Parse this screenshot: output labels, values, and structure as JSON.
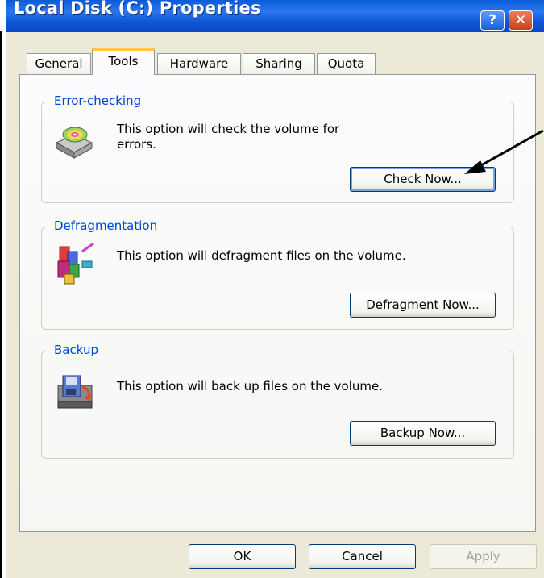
{
  "window": {
    "title": "Local Disk (C:) Properties",
    "help_glyph": "?",
    "close_glyph": "✕"
  },
  "tabs": [
    {
      "label": "General",
      "active": false
    },
    {
      "label": "Tools",
      "active": true
    },
    {
      "label": "Hardware",
      "active": false
    },
    {
      "label": "Sharing",
      "active": false
    },
    {
      "label": "Quota",
      "active": false
    }
  ],
  "groups": {
    "error_checking": {
      "title": "Error-checking",
      "text_line1": "This option will check the volume for",
      "text_line2": "errors.",
      "button": "Check Now...",
      "icon": "disk-check-icon"
    },
    "defragmentation": {
      "title": "Defragmentation",
      "text": "This option will defragment files on the volume.",
      "button": "Defragment Now...",
      "icon": "defragment-icon"
    },
    "backup": {
      "title": "Backup",
      "text": "This option will back up files on the volume.",
      "button": "Backup Now...",
      "icon": "backup-icon"
    }
  },
  "footer": {
    "ok": "OK",
    "cancel": "Cancel",
    "apply": "Apply"
  },
  "colors": {
    "titlebar": "#0a5bd8",
    "dialog_bg": "#ece9d8",
    "group_title": "#0046d5",
    "active_tab_accent": "#ffc83c"
  }
}
